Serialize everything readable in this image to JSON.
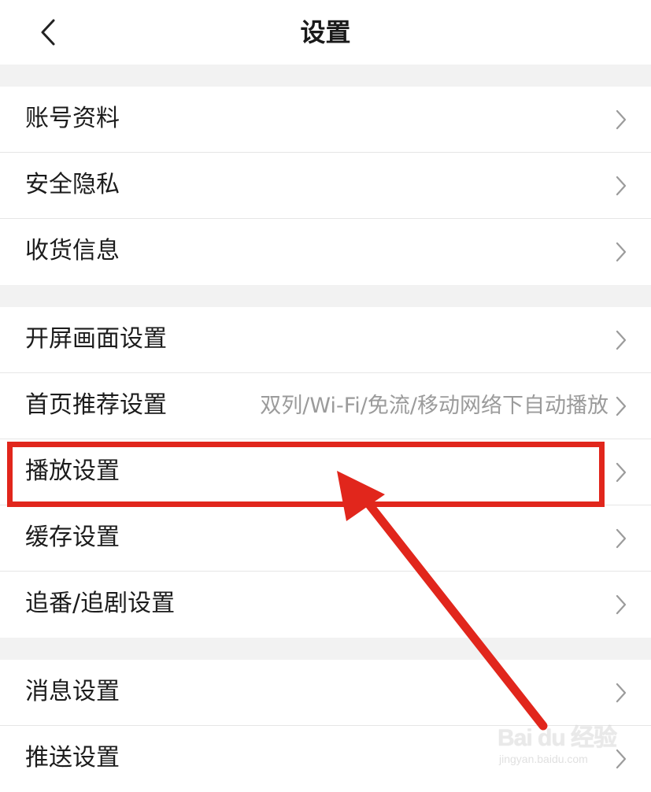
{
  "header": {
    "title": "设置",
    "back_icon": "chevron-left-icon"
  },
  "groups": [
    {
      "items": [
        {
          "label": "账号资料",
          "value": ""
        },
        {
          "label": "安全隐私",
          "value": ""
        },
        {
          "label": "收货信息",
          "value": ""
        }
      ]
    },
    {
      "items": [
        {
          "label": "开屏画面设置",
          "value": ""
        },
        {
          "label": "首页推荐设置",
          "value": "双列/Wi-Fi/免流/移动网络下自动播放"
        },
        {
          "label": "播放设置",
          "value": ""
        },
        {
          "label": "缓存设置",
          "value": ""
        },
        {
          "label": "追番/追剧设置",
          "value": ""
        }
      ]
    },
    {
      "items": [
        {
          "label": "消息设置",
          "value": ""
        },
        {
          "label": "推送设置",
          "value": ""
        }
      ]
    }
  ],
  "annotation": {
    "highlighted_item": "播放设置",
    "color": "#e1261c"
  },
  "watermark": {
    "brand": "Bai du 经验",
    "sub": "jingyan.baidu.com"
  },
  "colors": {
    "background": "#f2f2f2",
    "row_background": "#ffffff",
    "divider": "#e6e6e6",
    "secondary_text": "#9b9b9b",
    "annotation_red": "#e1261c"
  }
}
